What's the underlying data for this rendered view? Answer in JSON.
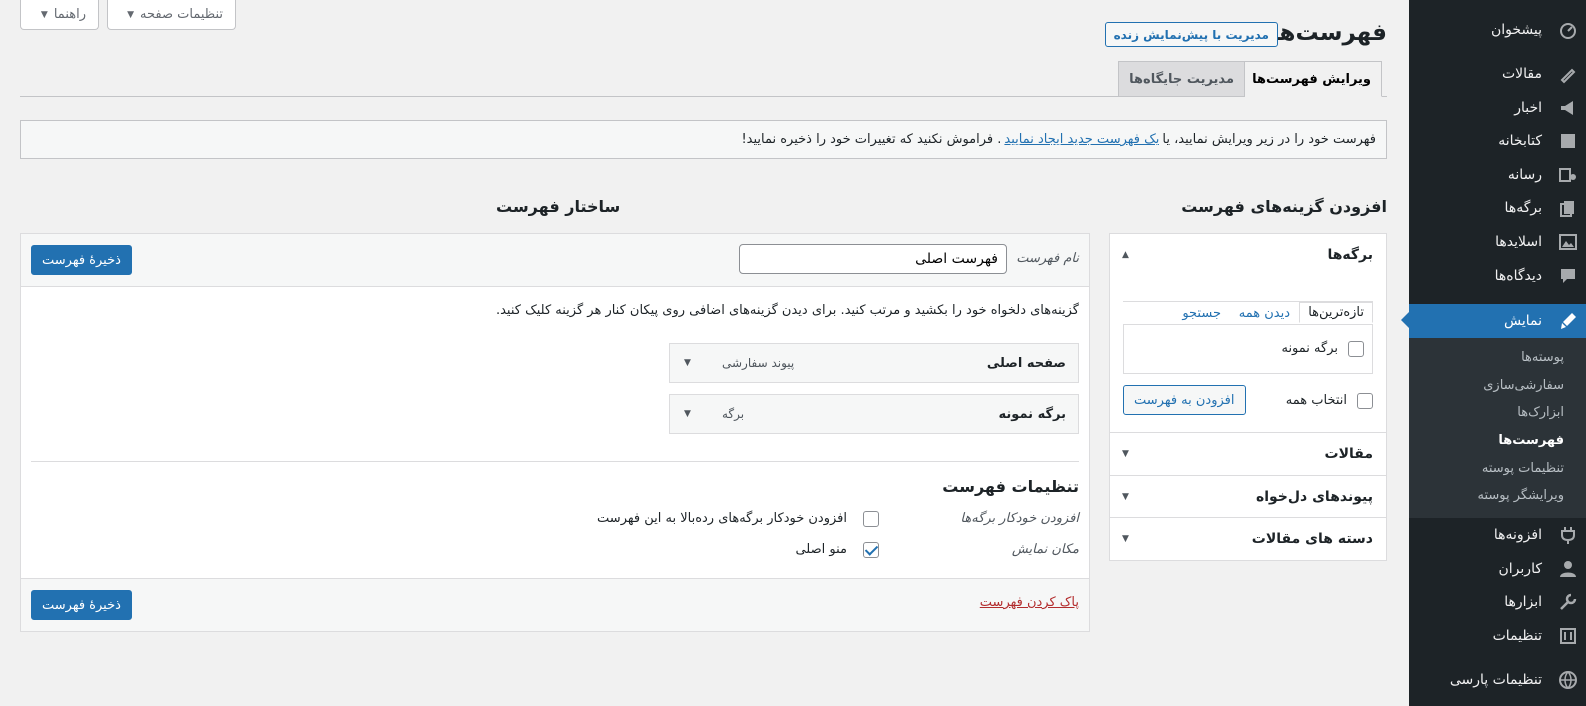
{
  "sidebar": {
    "items": [
      {
        "label": "پیشخوان",
        "icon": "dashboard-icon"
      },
      {
        "label": "مقالات",
        "icon": "pin-icon"
      },
      {
        "label": "اخبار",
        "icon": "megaphone-icon"
      },
      {
        "label": "کتابخانه",
        "icon": "book-icon"
      },
      {
        "label": "رسانه",
        "icon": "media-icon"
      },
      {
        "label": "برگه‌ها",
        "icon": "pages-icon"
      },
      {
        "label": "اسلایدها",
        "icon": "slides-icon"
      },
      {
        "label": "دیدگاه‌ها",
        "icon": "comment-icon"
      },
      {
        "label": "نمایش",
        "icon": "brush-icon"
      },
      {
        "label": "افزونه‌ها",
        "icon": "plugin-icon"
      },
      {
        "label": "کاربران",
        "icon": "user-icon"
      },
      {
        "label": "ابزارها",
        "icon": "wrench-icon"
      },
      {
        "label": "تنظیمات",
        "icon": "settings-icon"
      },
      {
        "label": "تنظیمات پارسی",
        "icon": "globe-icon"
      }
    ],
    "submenu": [
      "پوسته‌ها",
      "سفارشی‌سازی",
      "ابزارک‌ها",
      "فهرست‌ها",
      "تنظیمات پوسته",
      "ویرایشگر پوسته"
    ]
  },
  "screen_meta": {
    "options": "تنظیمات صفحه",
    "help": "راهنما"
  },
  "header": {
    "title": "فهرست‌ها",
    "live_button": "مدیریت با پیش‌نمایش زنده"
  },
  "tabs": {
    "edit": "ویرایش فهرست‌ها",
    "locations": "مدیریت جایگاه‌ها"
  },
  "notice": {
    "before": "فهرست خود را در زیر ویرایش نمایید، یا",
    "link": "یک فهرست جدید ایجاد نمایید",
    "after": ". فراموش نکنید که تغییرات خود را ذخیره نمایید!"
  },
  "add_items": {
    "title": "افزودن گزینه‌های فهرست",
    "pages_section": "برگه‌ها",
    "subtabs": {
      "recent": "تازه‌ترین‌ها",
      "all": "دیدن همه",
      "search": "جستجو"
    },
    "page_option": "برگه نمونه",
    "select_all": "انتخاب همه",
    "add_button": "افزودن به فهرست",
    "sections": [
      "مقالات",
      "پیوندهای دل‌خواه",
      "دسته های مقالات"
    ]
  },
  "structure": {
    "title": "ساختار فهرست",
    "name_label": "نام فهرست",
    "name_value": "فهرست اصلی",
    "save_button": "ذخیرهٔ فهرست",
    "instructions": "گزینه‌های دلخواه خود را بکشید و مرتب کنید. برای دیدن گزینه‌های اضافی روی پیکان کنار هر گزینه کلیک کنید.",
    "items": [
      {
        "title": "صفحه اصلی",
        "type": "پیوند سفارشی"
      },
      {
        "title": "برگه نمونه",
        "type": "برگه"
      }
    ],
    "settings_title": "تنظیمات فهرست",
    "auto_add_label": "افزودن خودکار برگه‌ها",
    "auto_add_option": "افزودن خودکار برگه‌های رده‌بالا به این فهرست",
    "location_label": "مکان نمایش",
    "location_option": "منو اصلی",
    "delete_link": "پاک کردن فهرست"
  }
}
